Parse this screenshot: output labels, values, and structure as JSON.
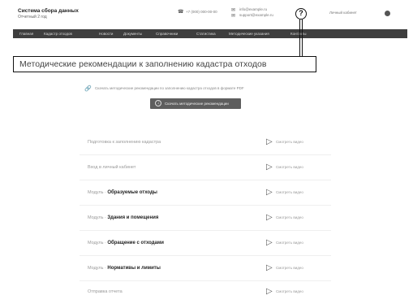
{
  "header": {
    "title": "Система сбора данных",
    "subtitle": "Отчетный 2 год",
    "contact1": "+7 (000) 000-00-00",
    "contact2a": "info@example.ru",
    "contact2b": "support@example.ru",
    "help_label": "?",
    "profile_label": "Личный кабинет"
  },
  "nav": {
    "items": [
      "Главная",
      "Кадастр отходов",
      "Новости",
      "Документы",
      "Справочники",
      "Статистика",
      "Методические указания",
      "Контакты"
    ]
  },
  "page": {
    "title": "Методические рекомендации к заполнению кадастра отходов",
    "link_text": "Скачать методические рекомендации по заполнению кадастра отходов в формате PDF",
    "download_button": "Скачать методические рекомендации"
  },
  "rows": [
    {
      "prefix": "Подготовка к заполнению кадастра",
      "bold": "",
      "link": "Смотреть видео"
    },
    {
      "prefix": "Вход в личный кабинет",
      "bold": "",
      "link": "Смотреть видео"
    },
    {
      "prefix": "Модуль ·",
      "bold": "Образуемые отходы",
      "link": "Смотреть видео"
    },
    {
      "prefix": "Модуль ·",
      "bold": "Здания и помещения",
      "link": "Смотреть видео"
    },
    {
      "prefix": "Модуль ·",
      "bold": "Обращение с отходами",
      "link": "Смотреть видео"
    },
    {
      "prefix": "Модуль ·",
      "bold": "Нормативы и лимиты",
      "link": "Смотреть видео"
    },
    {
      "prefix": "Отправка отчета",
      "bold": "",
      "link": "Смотреть видео"
    }
  ]
}
